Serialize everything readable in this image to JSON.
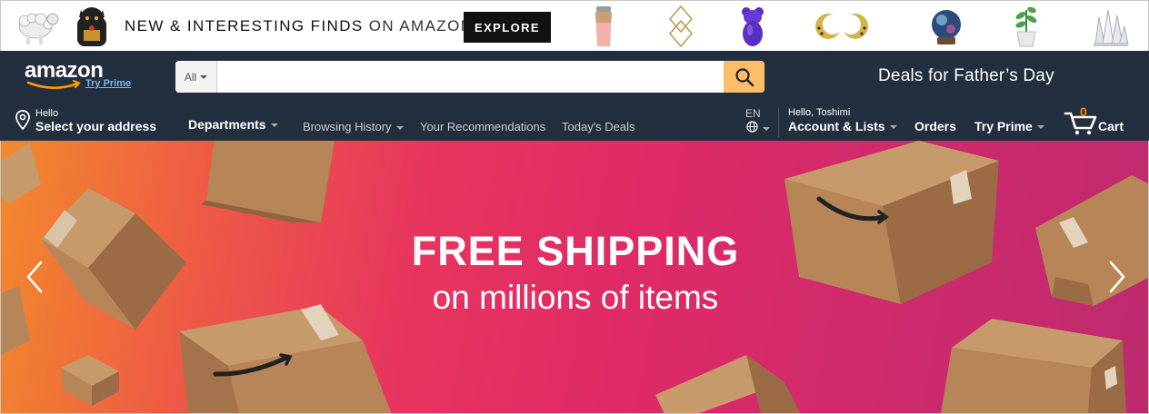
{
  "promo": {
    "headline_bold": "NEW & INTERESTING FINDS",
    "headline_light": "ON AMAZON",
    "cta_label": "EXPLORE"
  },
  "header": {
    "logo_text": "amazon",
    "logo_sub": "Try Prime",
    "search": {
      "category": "All",
      "value": "",
      "placeholder": ""
    },
    "promo_link": "Deals for Father’s Day"
  },
  "nav": {
    "address_greeting": "Hello",
    "address_label": "Select your address",
    "departments": "Departments",
    "links": [
      "Browsing History",
      "Your Recommendations",
      "Today's Deals"
    ],
    "language": "EN",
    "account_greeting": "Hello, Toshimi",
    "account_label": "Account & Lists",
    "orders": "Orders",
    "prime": "Try Prime",
    "cart_count": "0",
    "cart_label": "Cart"
  },
  "hero": {
    "title": "FREE SHIPPING",
    "subtitle": "on millions of items"
  },
  "colors": {
    "nav_bg": "#232f3e",
    "search_button": "#febd69",
    "cart_count": "#f08804",
    "prime_link": "#7fb5e6",
    "box_brown": "#b78658",
    "hero_gradient_start": "#f28a2c",
    "hero_gradient_end": "#bd2a6e"
  },
  "icons": {
    "search": "magnifier-icon",
    "location": "location-pin-icon",
    "language": "globe-icon",
    "cart": "cart-icon",
    "prev": "chevron-left-icon",
    "next": "chevron-right-icon"
  }
}
